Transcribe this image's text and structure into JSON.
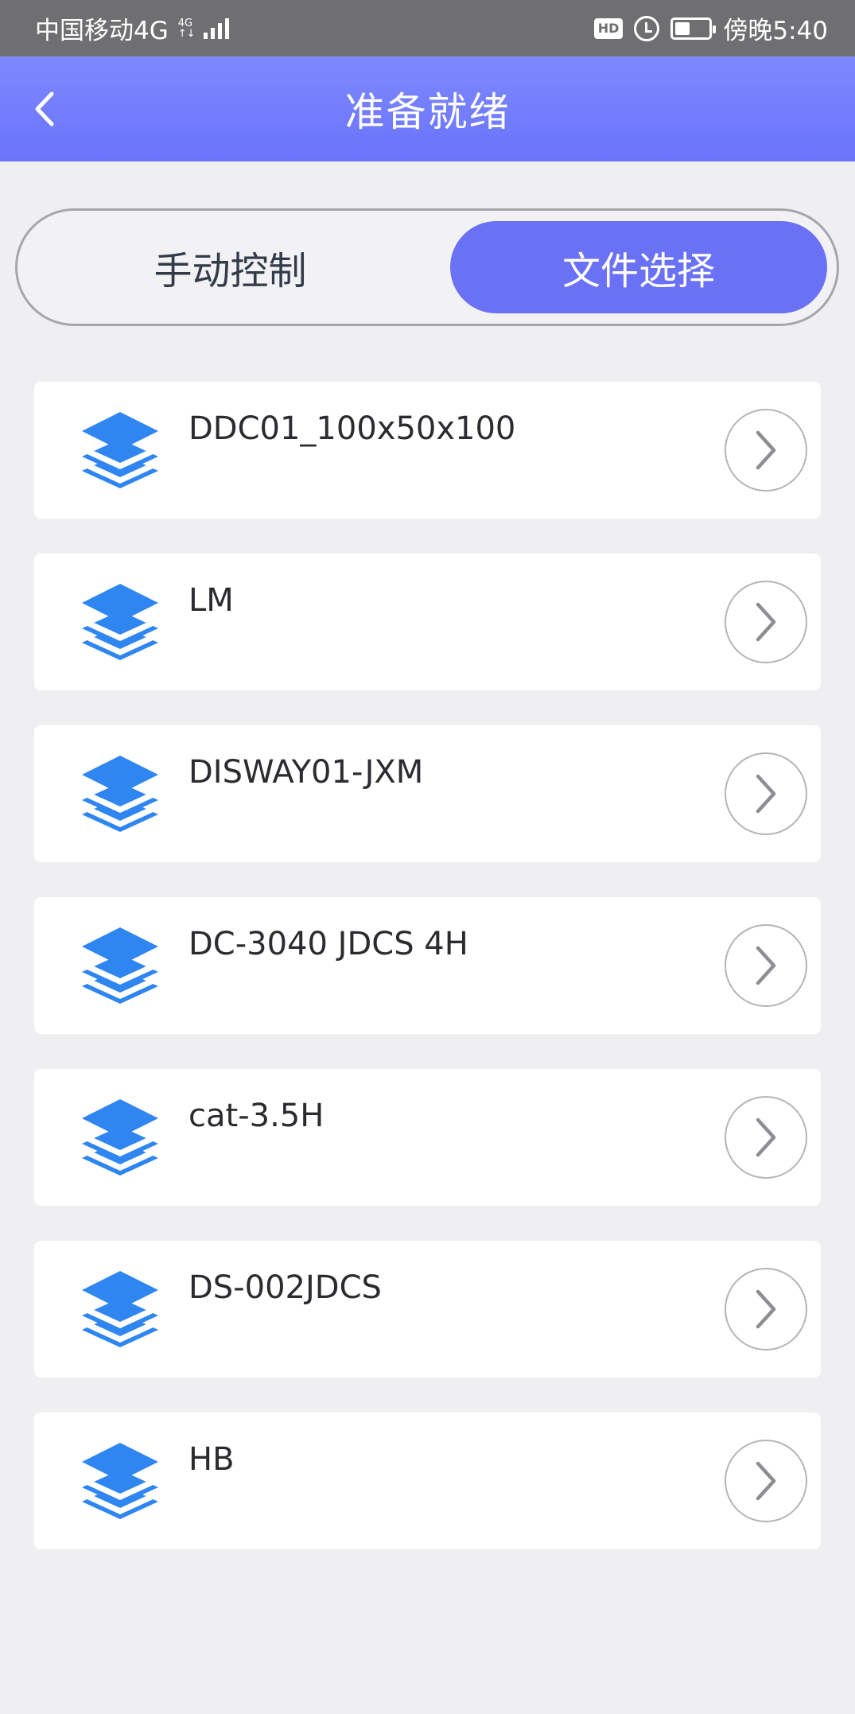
{
  "status_bar": {
    "carrier": "中国移动4G",
    "net_type_top": "4G",
    "net_type_bottom": "↑↓",
    "hd": "HD",
    "time": "傍晚5:40",
    "battery_level": 0.45
  },
  "header": {
    "title": "准备就绪",
    "back_icon": "chevron-left-icon"
  },
  "tabs": {
    "manual_label": "手动控制",
    "file_label": "文件选择",
    "selected": "文件选择"
  },
  "files": [
    {
      "name": "DDC01_100x50x100"
    },
    {
      "name": "LM"
    },
    {
      "name": "DISWAY01-JXM"
    },
    {
      "name": "DC-3040 JDCS 4H"
    },
    {
      "name": "cat-3.5H"
    },
    {
      "name": "DS-002JDCS"
    },
    {
      "name": "HB"
    }
  ],
  "colors": {
    "header": "#6f78fb",
    "accent": "#6b71f5",
    "icon_blue": "#2f86f0",
    "background": "#efeff1"
  },
  "icons": {
    "file": "layers-icon",
    "row_action": "chevron-right-icon"
  }
}
